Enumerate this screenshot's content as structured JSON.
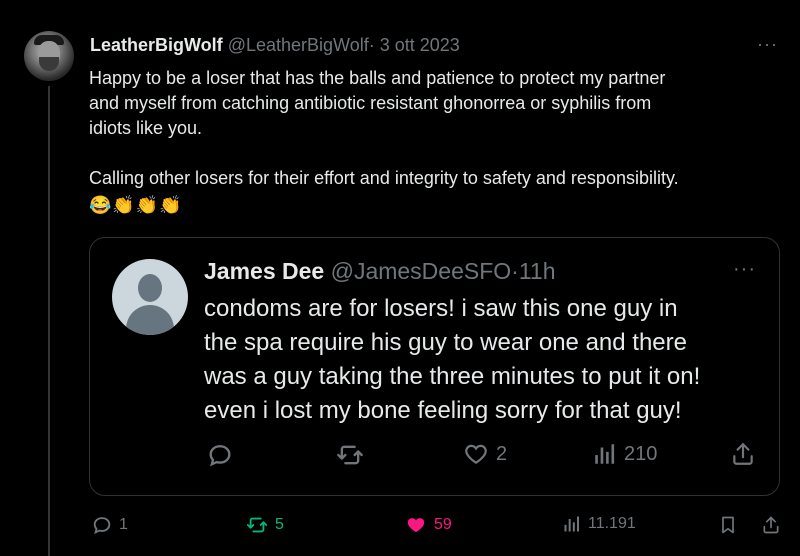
{
  "tweet": {
    "name": "LeatherBigWolf",
    "handle": "@LeatherBigWolf",
    "separator": "·",
    "date": "3 ott 2023",
    "more": "···",
    "lines": [
      "Happy to be a loser that has the balls and patience to protect my partner",
      "and myself from catching antibiotic resistant ghonorrea or syphilis from",
      "idiots like you."
    ],
    "line2": "Calling other losers for their effort and integrity to safety and responsibility.",
    "emojis": [
      "😂",
      "👏",
      "👏",
      "👏"
    ],
    "stats": {
      "replies": "1",
      "reposts": "5",
      "likes": "59",
      "views": "11.191"
    },
    "colors": {
      "repost": "#00ba7c",
      "like": "#f91880",
      "muted": "#71767b"
    }
  },
  "quote": {
    "name": "James Dee",
    "handle": "@JamesDeeSFO",
    "separator": "·",
    "time": "11h",
    "more": "···",
    "lines": [
      "condoms are for losers! i saw this one guy in",
      "the spa require his guy to wear one and there",
      "was a guy taking the three minutes to put it on!",
      "even i lost my bone feeling sorry for that guy!"
    ],
    "stats": {
      "likes": "2",
      "views": "210"
    }
  }
}
